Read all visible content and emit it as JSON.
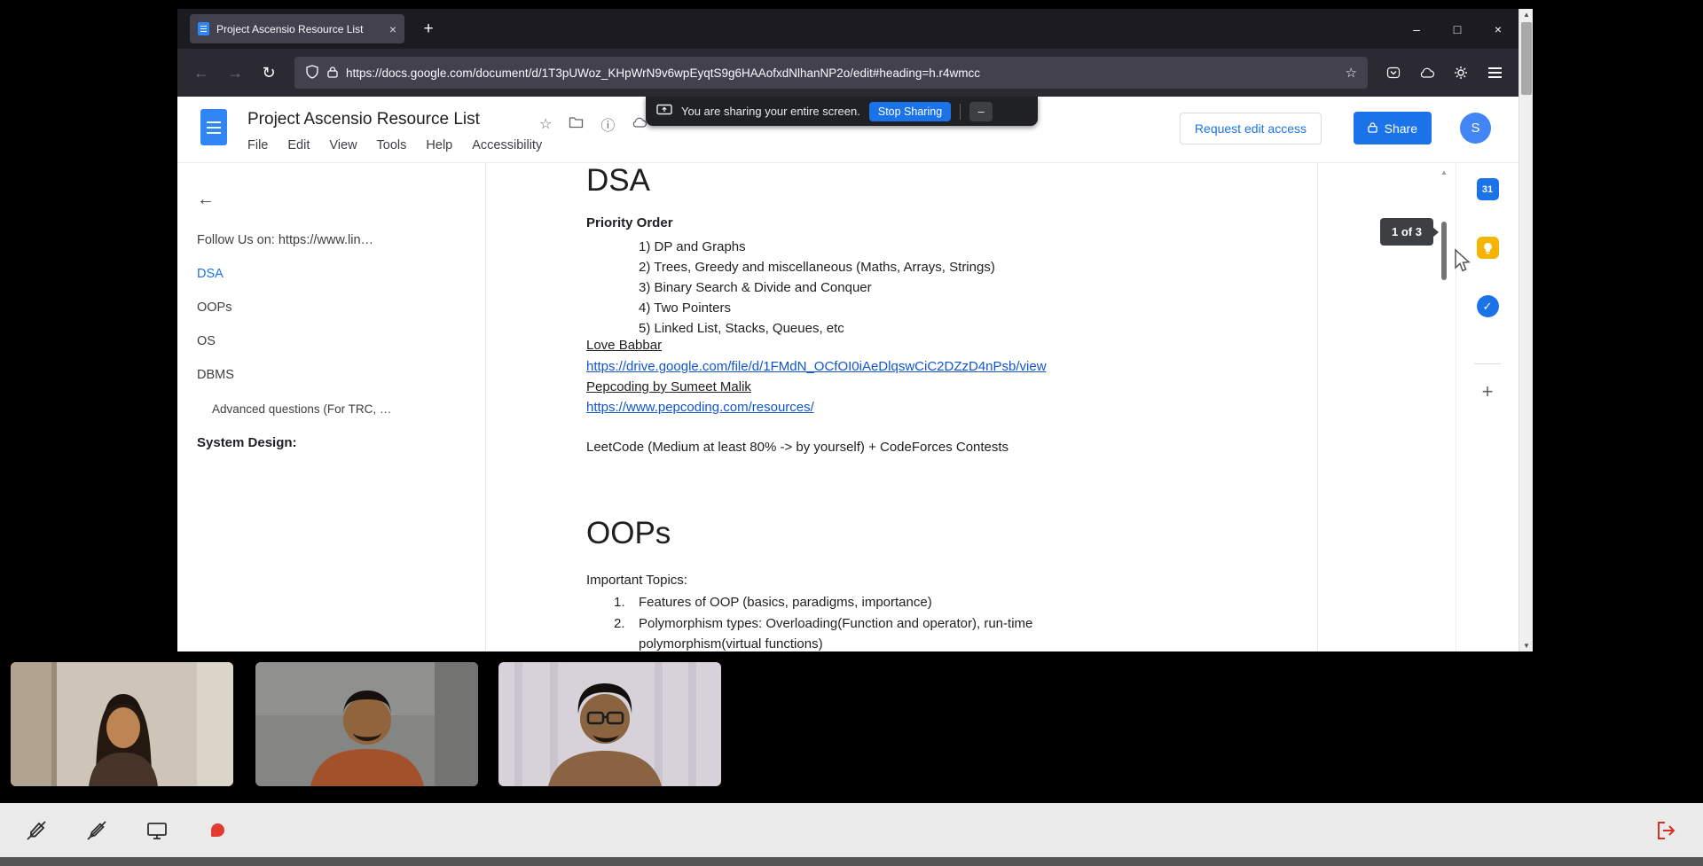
{
  "browser": {
    "tab_title": "Project Ascensio Resource List",
    "url": "https://docs.google.com/document/d/1T3pUWoz_KHpWrN9v6wpEyqtS9g6HAAofxdNlhanNP2o/edit#heading=h.r4wmcc"
  },
  "icons": {
    "tab_close": "×",
    "new_tab": "+",
    "minimize": "–",
    "maximize": "□",
    "close": "×",
    "back": "←",
    "forward": "→",
    "reload": "↻",
    "url_star": "☆",
    "header_star": "☆",
    "info": "ⓘ",
    "check": "✓",
    "side_plus": "+",
    "scroll_up": "▲",
    "scroll_down": "▼",
    "banner_minimize": "–",
    "calendar_day": "31",
    "outline_back": "←"
  },
  "docs": {
    "title": "Project Ascensio Resource List",
    "menu": [
      "File",
      "Edit",
      "View",
      "Tools",
      "Help",
      "Accessibility"
    ],
    "banner": {
      "text": "You are sharing your entire screen.",
      "stop_button": "Stop Sharing"
    },
    "request_edit_button": "Request edit access",
    "share_button": "Share",
    "avatar_initial": "S",
    "page_indicator": "1 of 3",
    "outline": [
      "Follow Us on: https://www.lin…",
      "DSA",
      "OOPs",
      "OS",
      "DBMS",
      "Advanced questions (For TRC, …",
      "System Design:"
    ],
    "document": {
      "h1": "DSA",
      "priority_title": "Priority Order",
      "priority_items": [
        "1) DP and Graphs",
        "2) Trees, Greedy and miscellaneous (Maths, Arrays, Strings)",
        "3) Binary Search & Divide and Conquer",
        "4) Two Pointers",
        "5) Linked List, Stacks, Queues, etc"
      ],
      "link1_label": "Love Babbar",
      "link1_url": "https://drive.google.com/file/d/1FMdN_OCfOI0iAeDlqswCiC2DZzD4nPsb/view",
      "link2_label": "Pepcoding by Sumeet Malik",
      "link2_url": "https://www.pepcoding.com/resources/",
      "leetcode_line": "LeetCode (Medium at least 80% -> by yourself) + CodeForces Contests",
      "h2": "OOPs",
      "oops_intro": "Important Topics:",
      "oops_items": [
        {
          "marker": "1.",
          "text": "Features of OOP (basics, paradigms,  importance)"
        },
        {
          "marker": "2.",
          "text": "Polymorphism types: Overloading(Function and operator),  run-time polymorphism(virtual functions)"
        }
      ]
    }
  },
  "meeting": {
    "participant_count": 3
  },
  "colors": {
    "accent_blue": "#1a73e8",
    "link_blue": "#1155cc",
    "banner_bg": "#202124",
    "keep_yellow": "#f5b400",
    "danger_red": "#d93025"
  }
}
